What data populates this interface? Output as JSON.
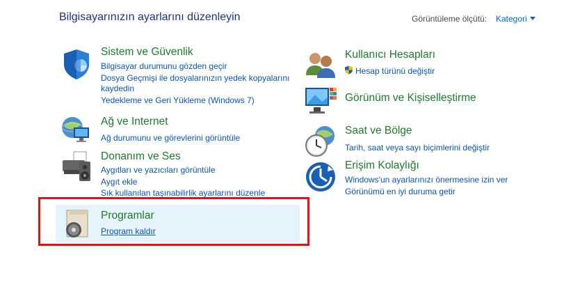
{
  "header": {
    "title": "Bilgisayarınızın ayarlarını düzenleyin",
    "view_by_label": "Görüntüleme ölçütü:",
    "view_by_value": "Kategori"
  },
  "categories_left": [
    {
      "title": "Sistem ve Güvenlik",
      "icon": "shield-icon",
      "links": [
        "Bilgisayar durumunu gözden geçir",
        "Dosya Geçmişi ile dosyalarınızın yedek kopyalarını",
        "kaydedin",
        "Yedekleme ve Geri Yükleme (Windows 7)"
      ]
    },
    {
      "title": "Ağ ve Internet",
      "icon": "network-globe-icon",
      "links": [
        "Ağ durumunu ve görevlerini görüntüle"
      ]
    },
    {
      "title": "Donanım ve Ses",
      "icon": "printer-icon",
      "links": [
        "Aygıtları ve yazıcıları görüntüle",
        "Aygıt ekle",
        "Sık kullanılan taşınabilirlik ayarlarını düzenle"
      ]
    },
    {
      "title": "Programlar",
      "icon": "programs-disc-icon",
      "links": [
        "Program kaldır"
      ]
    }
  ],
  "categories_right": [
    {
      "title": "Kullanıcı Hesapları",
      "icon": "users-icon",
      "links": [
        "Hesap türünü değiştir"
      ]
    },
    {
      "title": "Görünüm ve Kişiselleştirme",
      "icon": "monitor-personalize-icon",
      "links": []
    },
    {
      "title": "Saat ve Bölge",
      "icon": "clock-globe-icon",
      "links": [
        "Tarih, saat veya sayı biçimlerini değiştir"
      ]
    },
    {
      "title": "Erişim Kolaylığı",
      "icon": "ease-of-access-icon",
      "links": [
        "Windows'un ayarlarınızı önermesine izin ver",
        "Görünümü en iyi duruma getir"
      ]
    }
  ],
  "colors": {
    "title_blue": "#1e3287",
    "category_green": "#1f7a2c",
    "link_blue": "#0b55b5",
    "highlight": "#e5f3fb",
    "annotation_red": "#e11414"
  }
}
